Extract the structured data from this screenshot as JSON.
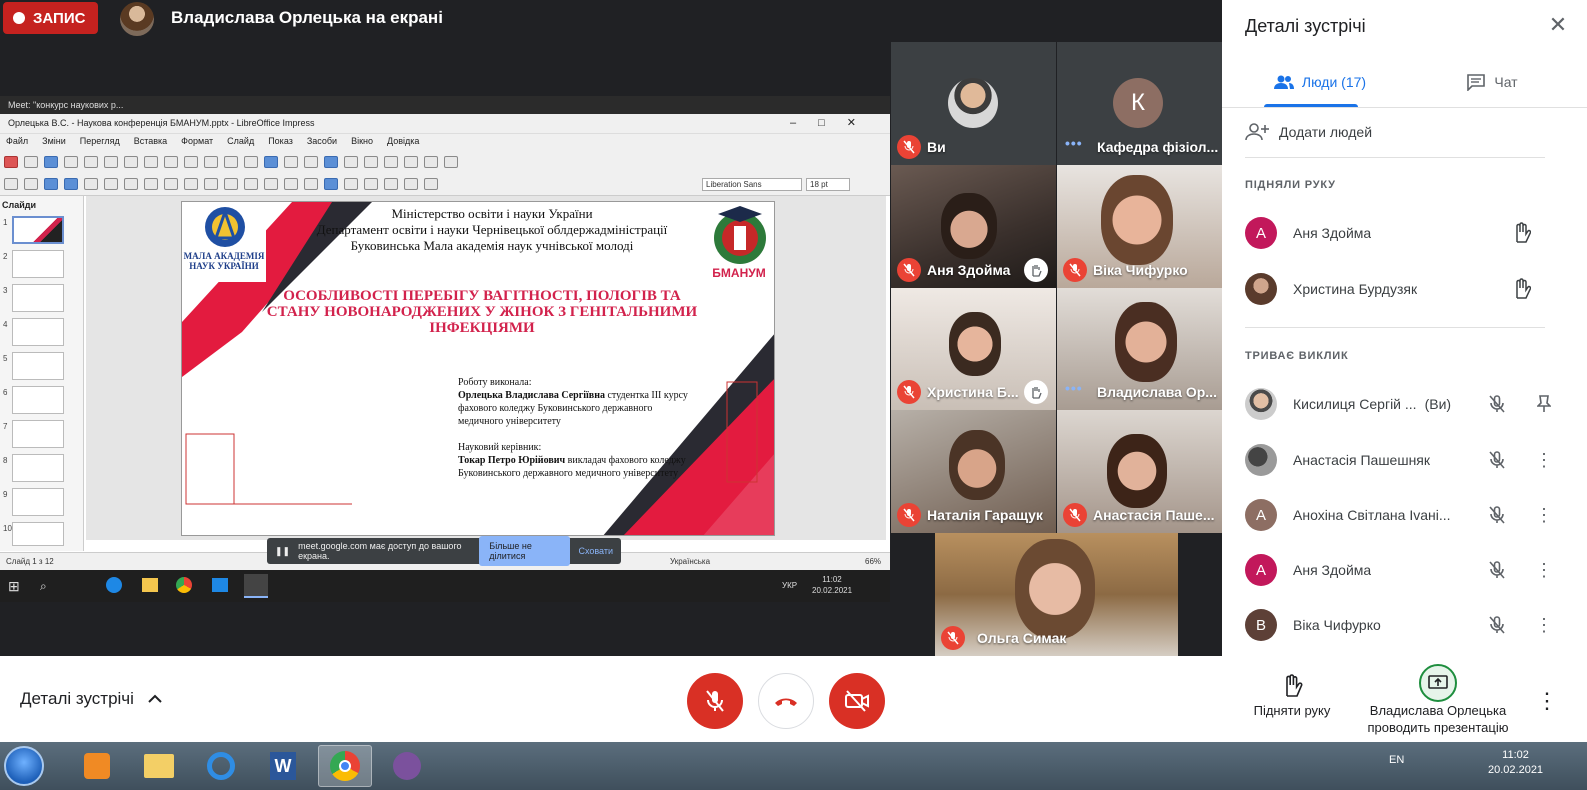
{
  "top": {
    "record_label": "ЗАПИС",
    "presenter_title": "Владислава Орлецька на екрані"
  },
  "screen": {
    "browser_tab": "Meet: \"конкурс наукових р...",
    "window_title": "Орлецька В.С. - Наукова конференція БМАНУМ.pptx - LibreOffice Impress",
    "menu": [
      "Файл",
      "Зміни",
      "Перегляд",
      "Вставка",
      "Формат",
      "Слайд",
      "Показ",
      "Засоби",
      "Вікно",
      "Довідка"
    ],
    "font_name": "Liberation Sans",
    "font_size": "18 pt",
    "slides_label": "Слайди",
    "slide_numbers": [
      "1",
      "2",
      "3",
      "4",
      "5",
      "6",
      "7",
      "8",
      "9",
      "10"
    ],
    "slide": {
      "header_lines": [
        "Міністерство освіти і науки України",
        "Департамент освіти і науки Чернівецької облдержадміністрації",
        "Буковинська Мала академія наук учнівської молоді"
      ],
      "logo_left_text": "МАЛА АКАДЕМІЯ НАУК УКРАЇНИ",
      "logo_right_text": "БМАНУМ",
      "title": "ОСОБЛИВОСТІ ПЕРЕБІГУ ВАГІТНОСТІ, ПОЛОГІВ ТА СТАНУ НОВОНАРОДЖЕНИХ У ЖІНОК З ГЕНІТАЛЬНИМИ ІНФЕКЦІЯМИ",
      "author_label": "Роботу виконала:",
      "author_name": "Орлецька Владислава Сергіївна",
      "author_rest": " студентка ІІІ курсу фахового коледжу Буковинського державного медичного університету",
      "advisor_label": "Науковий керівник:",
      "advisor_name": "Токар Петро Юрійович",
      "advisor_rest": " викладач фахового коледжу Буковинського державного медичного університету"
    },
    "status_slide": "Слайд 1 з 12",
    "status_lang": "Українська",
    "status_zoom": "66%",
    "share_notice": "meet.google.com має доступ до вашого екрана.",
    "share_stop": "Більше не ділитися",
    "share_hide": "Сховати",
    "inner_clock_time": "11:02",
    "inner_clock_date": "20.02.2021",
    "inner_lang": "УКР"
  },
  "tiles": [
    {
      "name": "Ви"
    },
    {
      "name": "Кафедра фізіол...",
      "initial": "К"
    },
    {
      "name": "Аня Здойма"
    },
    {
      "name": "Віка Чифурко"
    },
    {
      "name": "Христина Б..."
    },
    {
      "name": "Владислава Ор..."
    },
    {
      "name": "Наталія Гаращук"
    },
    {
      "name": "Анастасія Паше..."
    },
    {
      "name": "Ольга Симак"
    }
  ],
  "panel": {
    "title": "Деталі зустрічі",
    "tab_people": "Люди (17)",
    "tab_chat": "Чат",
    "add_people": "Додати людей",
    "raised_head": "ПІДНЯЛИ РУКУ",
    "raised": [
      {
        "name": "Аня Здойма",
        "initial": "А",
        "color": "#c2185b"
      },
      {
        "name": "Христина Бурдузяк",
        "initial": "",
        "color": "#6d4c41"
      }
    ],
    "call_head": "ТРИВАЄ ВИКЛИК",
    "call": [
      {
        "name": "Кисилиця Сергій ...",
        "suffix": "(Ви)",
        "initial": "",
        "color": "#8d6e63"
      },
      {
        "name": "Анастасія Пашешняк",
        "initial": "",
        "color": "#424242"
      },
      {
        "name": "Анохіна Світлана Іvані...",
        "initial": "А",
        "color": "#8d6e63"
      },
      {
        "name": "Аня Здойма",
        "initial": "А",
        "color": "#c2185b"
      },
      {
        "name": "Віка Чифурко",
        "initial": "В",
        "color": "#5d4037"
      }
    ]
  },
  "bottom": {
    "details": "Деталі зустрічі",
    "raise_hand": "Підняти руку",
    "presenting": "Владислава Орлецька проводить презентацію"
  },
  "taskbar": {
    "lang": "EN",
    "time": "11:02",
    "date": "20.02.2021"
  }
}
